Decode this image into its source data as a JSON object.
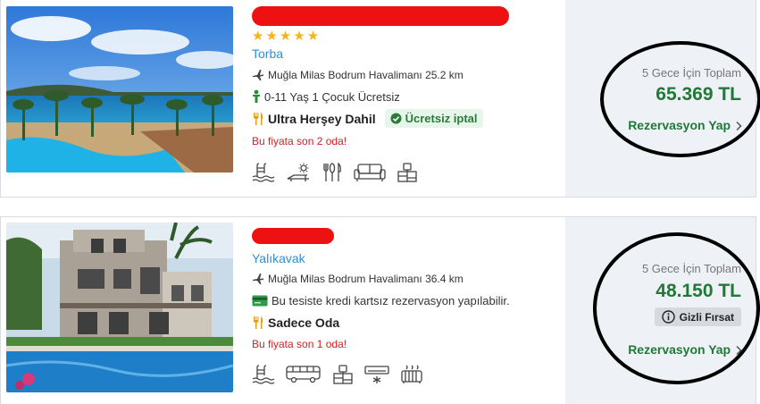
{
  "listings": [
    {
      "stars": "★★★★★",
      "location": "Torba",
      "airport": "Muğla Milas Bodrum Havalimanı 25.2 km",
      "child_policy": "0-11 Yaş 1 Çocuk Ücretsiz",
      "board": "Ultra Herşey Dahil",
      "cancel_badge": "Ücretsiz iptal",
      "availability": "Bu fiyata son 2 oda!",
      "total_label": "5 Gece İçin Toplam",
      "price": "65.369 TL",
      "cta": "Rezervasyon Yap"
    },
    {
      "location": "Yalıkavak",
      "airport": "Muğla Milas Bodrum Havalimanı 36.4 km",
      "payment_note": "Bu tesiste kredi kartsız rezervasyon yapılabilir.",
      "board": "Sadece Oda",
      "availability": "Bu fiyata son 1 oda!",
      "total_label": "5 Gece İçin Toplam",
      "price": "48.150 TL",
      "deal_badge": "Gizli Fırsat",
      "cta": "Rezervasyon Yap"
    }
  ],
  "icons": {
    "listing_1": [
      "pool-icon",
      "sunbed-icon",
      "restaurant-icon",
      "sofa-icon",
      "desk-icon"
    ],
    "listing_2": [
      "pool-icon",
      "shuttle-bus-icon",
      "desk-icon",
      "air-conditioner-icon",
      "heater-icon"
    ]
  },
  "colors": {
    "price_green": "#1f7a35",
    "link_blue": "#2f8fd8",
    "alert_red": "#d02020",
    "star_gold": "#f5b41a",
    "redaction_red": "#ee1111"
  }
}
